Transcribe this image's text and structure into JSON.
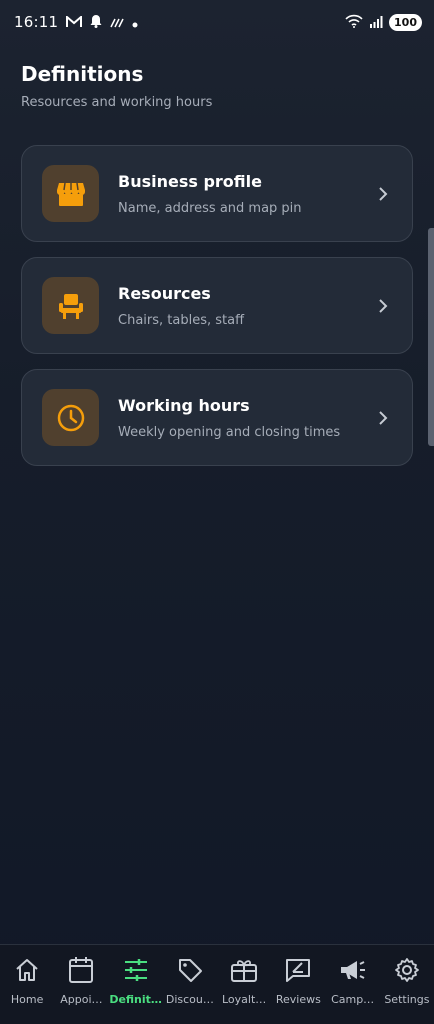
{
  "status": {
    "time": "16:11",
    "battery": "100"
  },
  "header": {
    "title": "Definitions",
    "subtitle": "Resources and working hours"
  },
  "cards": [
    {
      "title": "Business profile",
      "desc": "Name, address and map pin",
      "icon": "storefront-icon"
    },
    {
      "title": "Resources",
      "desc": "Chairs, tables, staff",
      "icon": "chair-icon"
    },
    {
      "title": "Working hours",
      "desc": "Weekly opening and closing times",
      "icon": "clock-icon"
    }
  ],
  "nav": [
    {
      "label": "Home",
      "icon": "home-icon"
    },
    {
      "label": "Appoi…",
      "icon": "calendar-icon"
    },
    {
      "label": "Definit…",
      "icon": "sliders-icon",
      "active": true
    },
    {
      "label": "Discou…",
      "icon": "tag-icon"
    },
    {
      "label": "Loyalt…",
      "icon": "gift-card-icon"
    },
    {
      "label": "Reviews",
      "icon": "review-icon"
    },
    {
      "label": "Camp…",
      "icon": "megaphone-icon"
    },
    {
      "label": "Settings",
      "icon": "gear-icon"
    }
  ],
  "colors": {
    "accent": "#f59e0b",
    "active_nav": "#4ade80",
    "background": "#161d2a"
  }
}
